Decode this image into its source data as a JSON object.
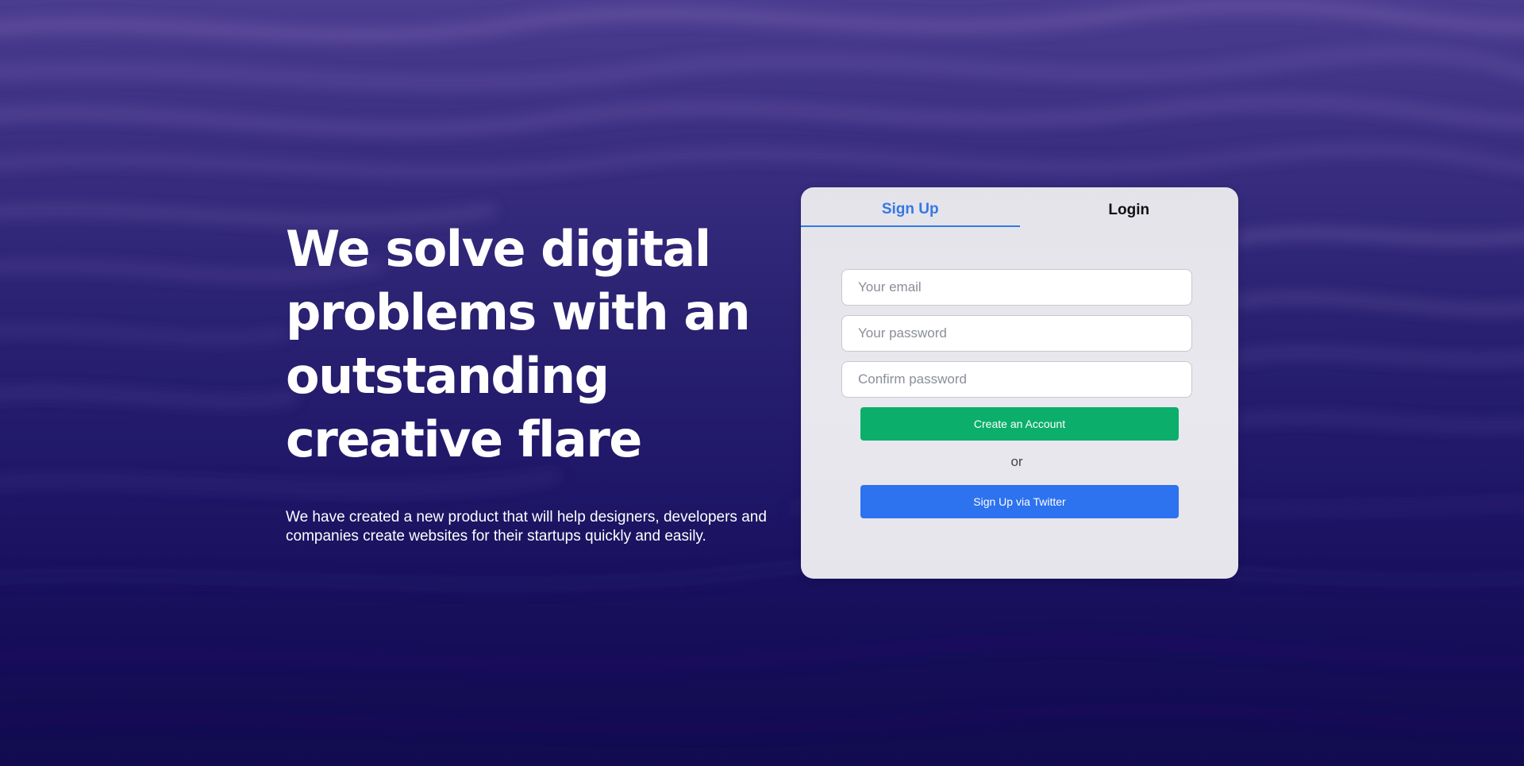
{
  "hero": {
    "title": "We solve digital problems with an outstanding creative flare",
    "subtitle": "We have created a new product that will help designers, developers and companies create websites for their startups quickly and easily."
  },
  "auth_card": {
    "tabs": [
      {
        "label": "Sign Up",
        "active": true
      },
      {
        "label": "Login",
        "active": false
      }
    ],
    "email_placeholder": "Your email",
    "password_placeholder": "Your password",
    "confirm_placeholder": "Confirm password",
    "create_button": "Create an Account",
    "or_text": "or",
    "twitter_button": "Sign Up via Twitter"
  },
  "colors": {
    "accent_blue": "#3578e5",
    "create_green": "#0baf6b",
    "twitter_blue": "#2d72ee",
    "background_navy": "#1a1059"
  }
}
